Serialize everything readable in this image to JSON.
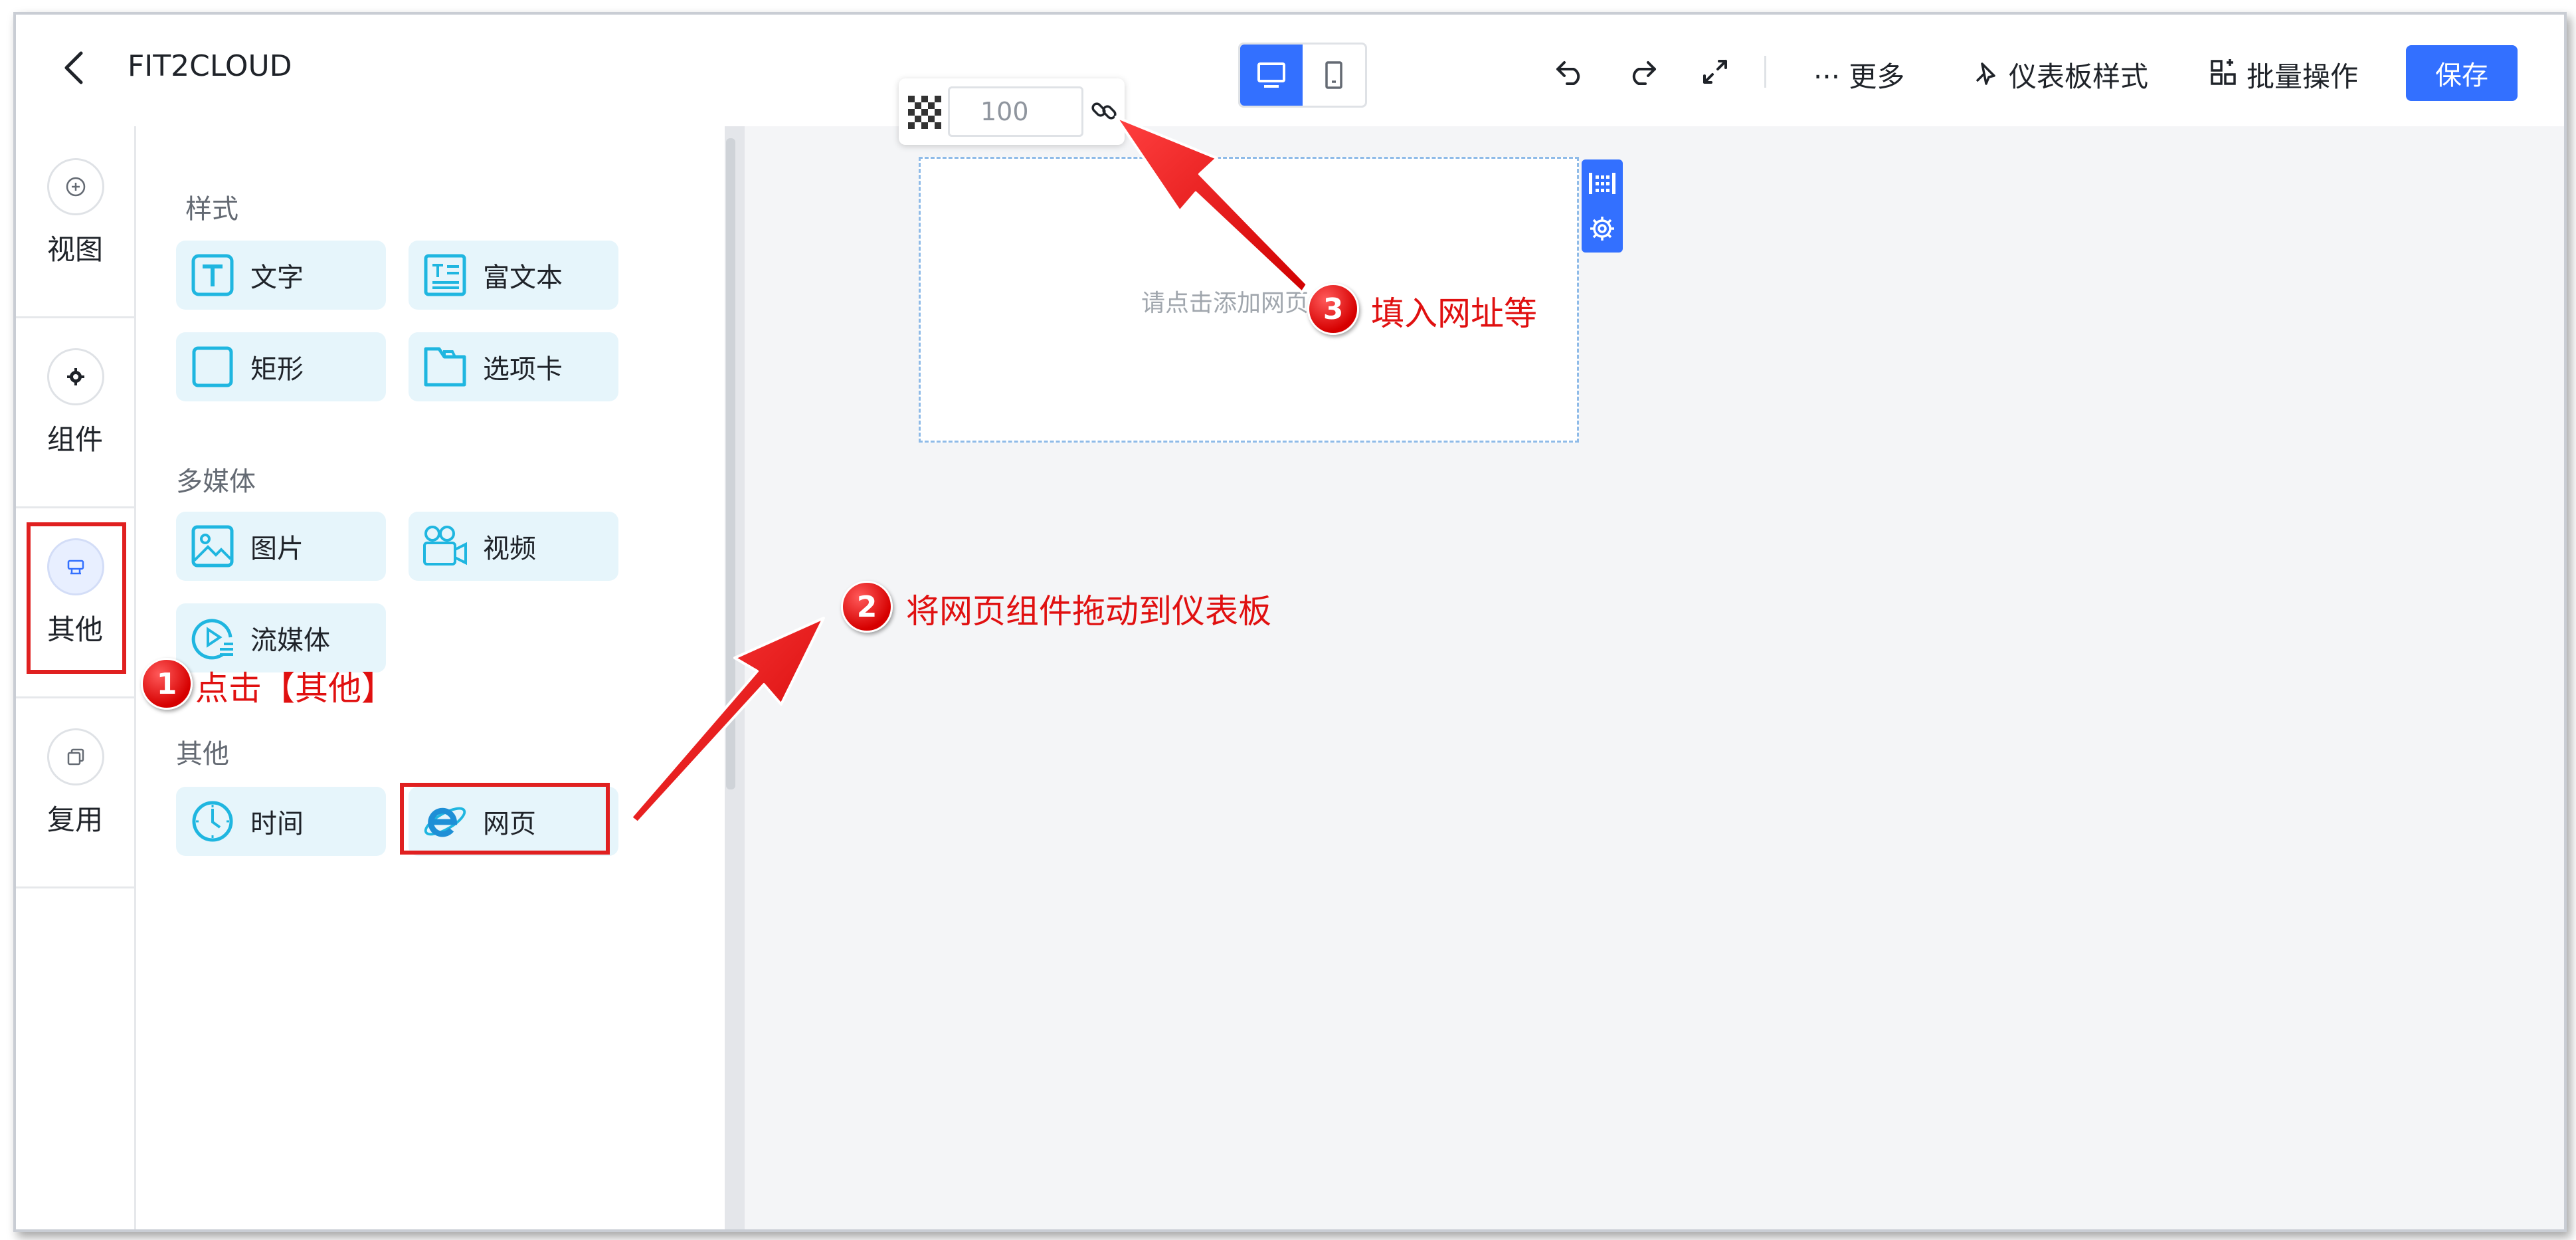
{
  "header": {
    "title": "FIT2CLOUD",
    "more_label": "··· 更多",
    "style_label": "仪表板样式",
    "batch_label": "批量操作",
    "save_label": "保存"
  },
  "toolbar_popup": {
    "opacity_value": "100"
  },
  "rail": {
    "items": [
      {
        "label": "视图"
      },
      {
        "label": "组件"
      },
      {
        "label": "其他"
      },
      {
        "label": "复用"
      }
    ]
  },
  "panel": {
    "sections": [
      {
        "title": "样式",
        "items": [
          "文字",
          "富文本",
          "矩形",
          "选项卡"
        ]
      },
      {
        "title": "多媒体",
        "items": [
          "图片",
          "视频",
          "流媒体"
        ]
      },
      {
        "title": "其他",
        "items": [
          "时间",
          "网页"
        ]
      }
    ]
  },
  "canvas": {
    "webpage_placeholder": "请点击添加网页信息"
  },
  "annotations": {
    "step1": {
      "num": "1",
      "text": "点击【其他】"
    },
    "step2": {
      "num": "2",
      "text": "将网页组件拖动到仪表板"
    },
    "step3": {
      "num": "3",
      "text": "填入网址等"
    }
  },
  "colors": {
    "accent": "#3370ff",
    "annotation_red": "#e02020",
    "component_bg": "#e6f5fb",
    "icon_teal": "#1fb6e0"
  }
}
